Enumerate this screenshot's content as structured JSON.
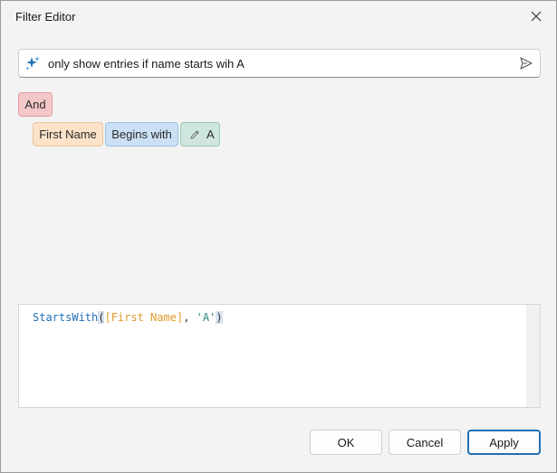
{
  "window": {
    "title": "Filter Editor"
  },
  "icons": {
    "close": "close-icon",
    "sparkle": "sparkle-icon",
    "send": "send-icon",
    "pencil": "pencil-icon"
  },
  "prompt": {
    "value": "only show entries if name starts wih A"
  },
  "filter": {
    "group": "And",
    "field": "First Name",
    "operator": "Begins with",
    "value": "A"
  },
  "expression": {
    "function": "StartsWith",
    "open_paren": "(",
    "field": "[First Name]",
    "separator": ", ",
    "string": "'A'",
    "close_paren": ")"
  },
  "buttons": {
    "ok": "OK",
    "cancel": "Cancel",
    "apply": "Apply"
  },
  "colors": {
    "group_chip": "#f4c7c9",
    "field_chip": "#fbe2c8",
    "operator_chip": "#cbe0f5",
    "value_chip": "#cfe6de",
    "accent": "#1f6fb5"
  }
}
